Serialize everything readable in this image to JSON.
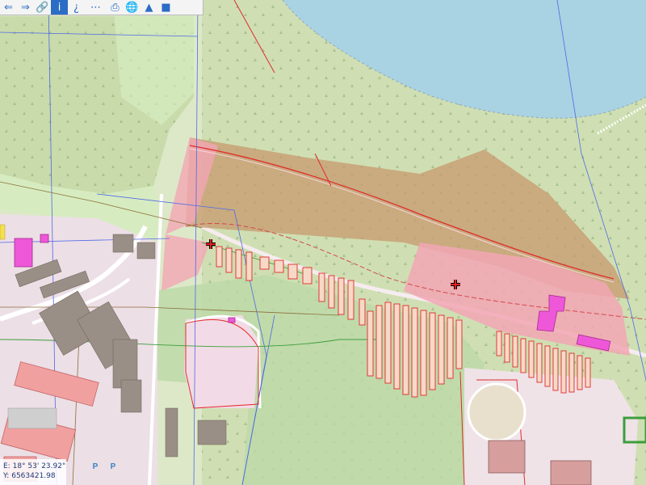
{
  "toolbar": {
    "tools": [
      {
        "name": "pan-left-icon",
        "glyph": "⇐"
      },
      {
        "name": "pan-right-icon",
        "glyph": "⇒"
      },
      {
        "name": "link-icon",
        "glyph": "🔗"
      },
      {
        "name": "info-icon",
        "glyph": "i"
      },
      {
        "name": "info-query-icon",
        "glyph": "¿"
      },
      {
        "name": "measure-icon",
        "glyph": "⋯"
      },
      {
        "name": "print-icon",
        "glyph": "⎙"
      },
      {
        "name": "globe-icon",
        "glyph": "🌐"
      },
      {
        "name": "warning-icon",
        "glyph": "▲"
      },
      {
        "name": "video-icon",
        "glyph": "■"
      }
    ],
    "active_tool": "info-icon"
  },
  "coordinates": {
    "e_label": "E:",
    "e_value": "18° 53' 23.92\"",
    "y_label": "Y:",
    "y_value": "6563421.98"
  },
  "map_labels": {
    "parking_1": "P",
    "parking_2": "P"
  },
  "colors": {
    "water": "#a9d2e3",
    "wood": "#c9dbab",
    "meadow": "#d6ecc0",
    "residential": "#f0d8df",
    "brown_parcel": "#c79a6e",
    "pink_parcel": "#f2a6b4",
    "building": "#f1a0a0",
    "magenta_building": "#ee58d8",
    "utility_red": "#e12b2b",
    "utility_blue": "#4f69e6",
    "utility_green": "#3c9e3c",
    "road": "#ffffff"
  }
}
